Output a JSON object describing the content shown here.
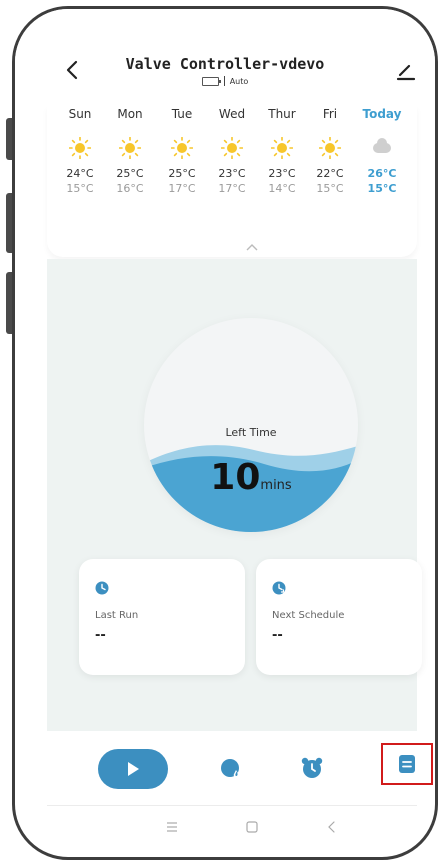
{
  "header": {
    "title": "Valve Controller-vdevo",
    "mode": "Auto",
    "icons": {
      "back": "chevron-left-icon",
      "edit": "pencil-icon",
      "battery": "battery-icon"
    }
  },
  "weather": {
    "days": [
      {
        "name": "Sun",
        "icon": "sun-icon",
        "high": "24°C",
        "low": "15°C"
      },
      {
        "name": "Mon",
        "icon": "sun-icon",
        "high": "25°C",
        "low": "16°C"
      },
      {
        "name": "Tue",
        "icon": "sun-icon",
        "high": "25°C",
        "low": "17°C"
      },
      {
        "name": "Wed",
        "icon": "sun-icon",
        "high": "23°C",
        "low": "17°C"
      },
      {
        "name": "Thur",
        "icon": "sun-icon",
        "high": "23°C",
        "low": "14°C"
      },
      {
        "name": "Fri",
        "icon": "sun-icon",
        "high": "22°C",
        "low": "15°C"
      },
      {
        "name": "Today",
        "icon": "cloud-icon",
        "high": "26°C",
        "low": "15°C"
      }
    ]
  },
  "timer": {
    "label": "Left Time",
    "value": "10",
    "unit": "mins"
  },
  "cards": {
    "last_run": {
      "label": "Last Run",
      "value": "--"
    },
    "next_schedule": {
      "label": "Next Schedule",
      "value": "--"
    }
  },
  "tabs": [
    {
      "name": "play",
      "icon": "play-icon"
    },
    {
      "name": "water",
      "icon": "water-drop-icon"
    },
    {
      "name": "alarm",
      "icon": "alarm-clock-icon"
    },
    {
      "name": "log",
      "icon": "log-icon",
      "highlighted": true
    }
  ],
  "nav": {
    "menu": "menu-icon",
    "home": "home-icon",
    "back": "back-icon"
  },
  "colors": {
    "accent": "#3c8fc0",
    "today": "#3e9ed0",
    "sun": "#f7c62b",
    "highlight": "#d11b1b",
    "background": "#eef3f2"
  }
}
